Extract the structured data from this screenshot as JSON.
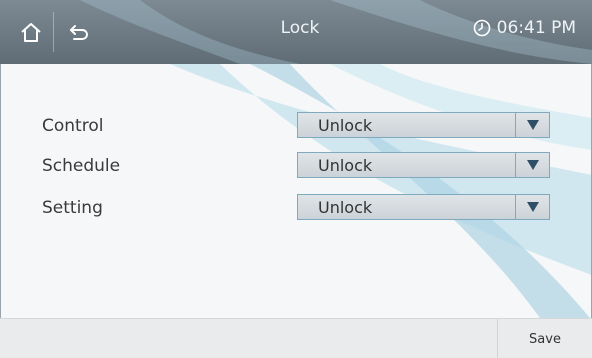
{
  "header": {
    "title": "Lock",
    "time": "06:41 PM",
    "home_icon": "home-icon",
    "back_icon": "back-icon",
    "clock_icon": "clock-icon"
  },
  "form": {
    "rows": [
      {
        "label": "Control",
        "value": "Unlock"
      },
      {
        "label": "Schedule",
        "value": "Unlock"
      },
      {
        "label": "Setting",
        "value": "Unlock"
      }
    ]
  },
  "footer": {
    "save_label": "Save"
  },
  "colors": {
    "header_bg": "#6b7882",
    "swoosh": "#b9dce7",
    "dropdown_border": "#7fa9bf",
    "arrow": "#2f4f66"
  }
}
